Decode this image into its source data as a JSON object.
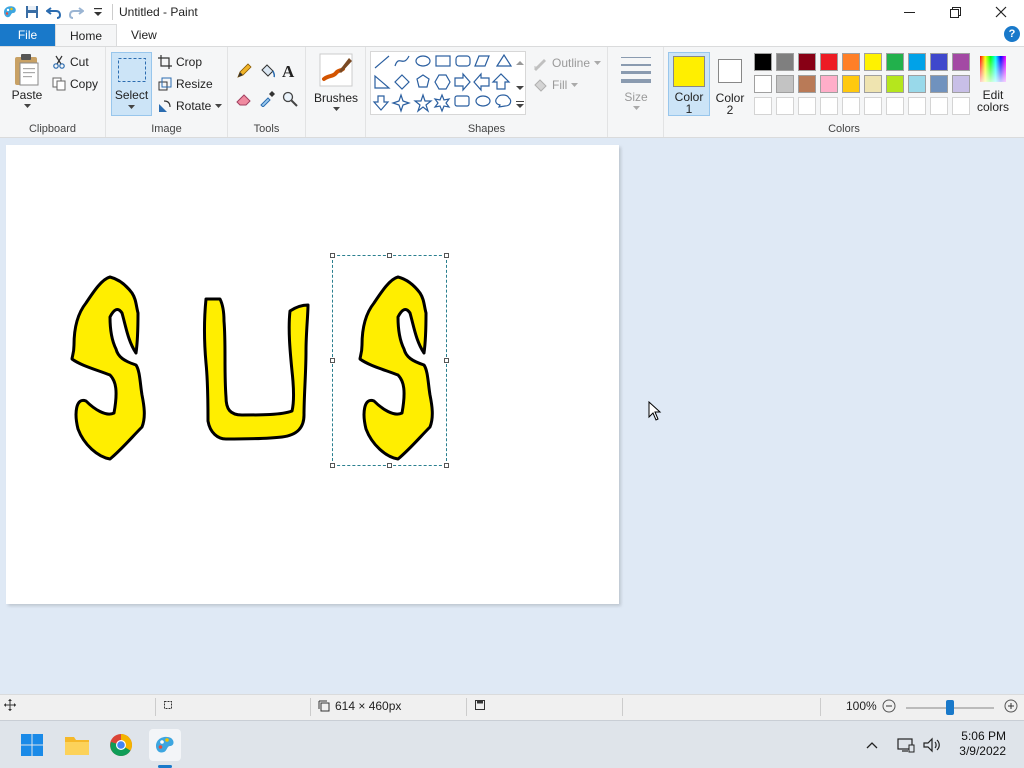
{
  "window": {
    "title": "Untitled - Paint"
  },
  "tabs": {
    "file": "File",
    "home": "Home",
    "view": "View",
    "help": "?"
  },
  "clipboard": {
    "paste": "Paste",
    "cut": "Cut",
    "copy": "Copy",
    "label": "Clipboard"
  },
  "image": {
    "select": "Select",
    "crop": "Crop",
    "resize": "Resize",
    "rotate": "Rotate",
    "label": "Image"
  },
  "tools": {
    "label": "Tools"
  },
  "brushes": {
    "label": "Brushes"
  },
  "shapes": {
    "outline": "Outline",
    "fill": "Fill",
    "label": "Shapes"
  },
  "size": {
    "label": "Size"
  },
  "colors": {
    "color1_line1": "Color",
    "color1_line2": "1",
    "color2_line1": "Color",
    "color2_line2": "2",
    "edit_line1": "Edit",
    "edit_line2": "colors",
    "label": "Colors",
    "color1_value": "#ffef00",
    "color2_value": "#ffffff",
    "palette_row1": [
      "#000000",
      "#7f7f7f",
      "#880015",
      "#ed1c24",
      "#ff7f27",
      "#fff200",
      "#22b14c",
      "#00a2e8",
      "#3f48cc",
      "#a349a4"
    ],
    "palette_row2": [
      "#ffffff",
      "#c3c3c3",
      "#b97a57",
      "#ffaec9",
      "#ffc90e",
      "#efe4b0",
      "#b5e61d",
      "#99d9ea",
      "#7092be",
      "#c8bfe7"
    ]
  },
  "status": {
    "dimensions": "614 × 460px",
    "zoom": "100%"
  },
  "taskbar": {
    "time": "5:06 PM",
    "date": "3/9/2022"
  }
}
